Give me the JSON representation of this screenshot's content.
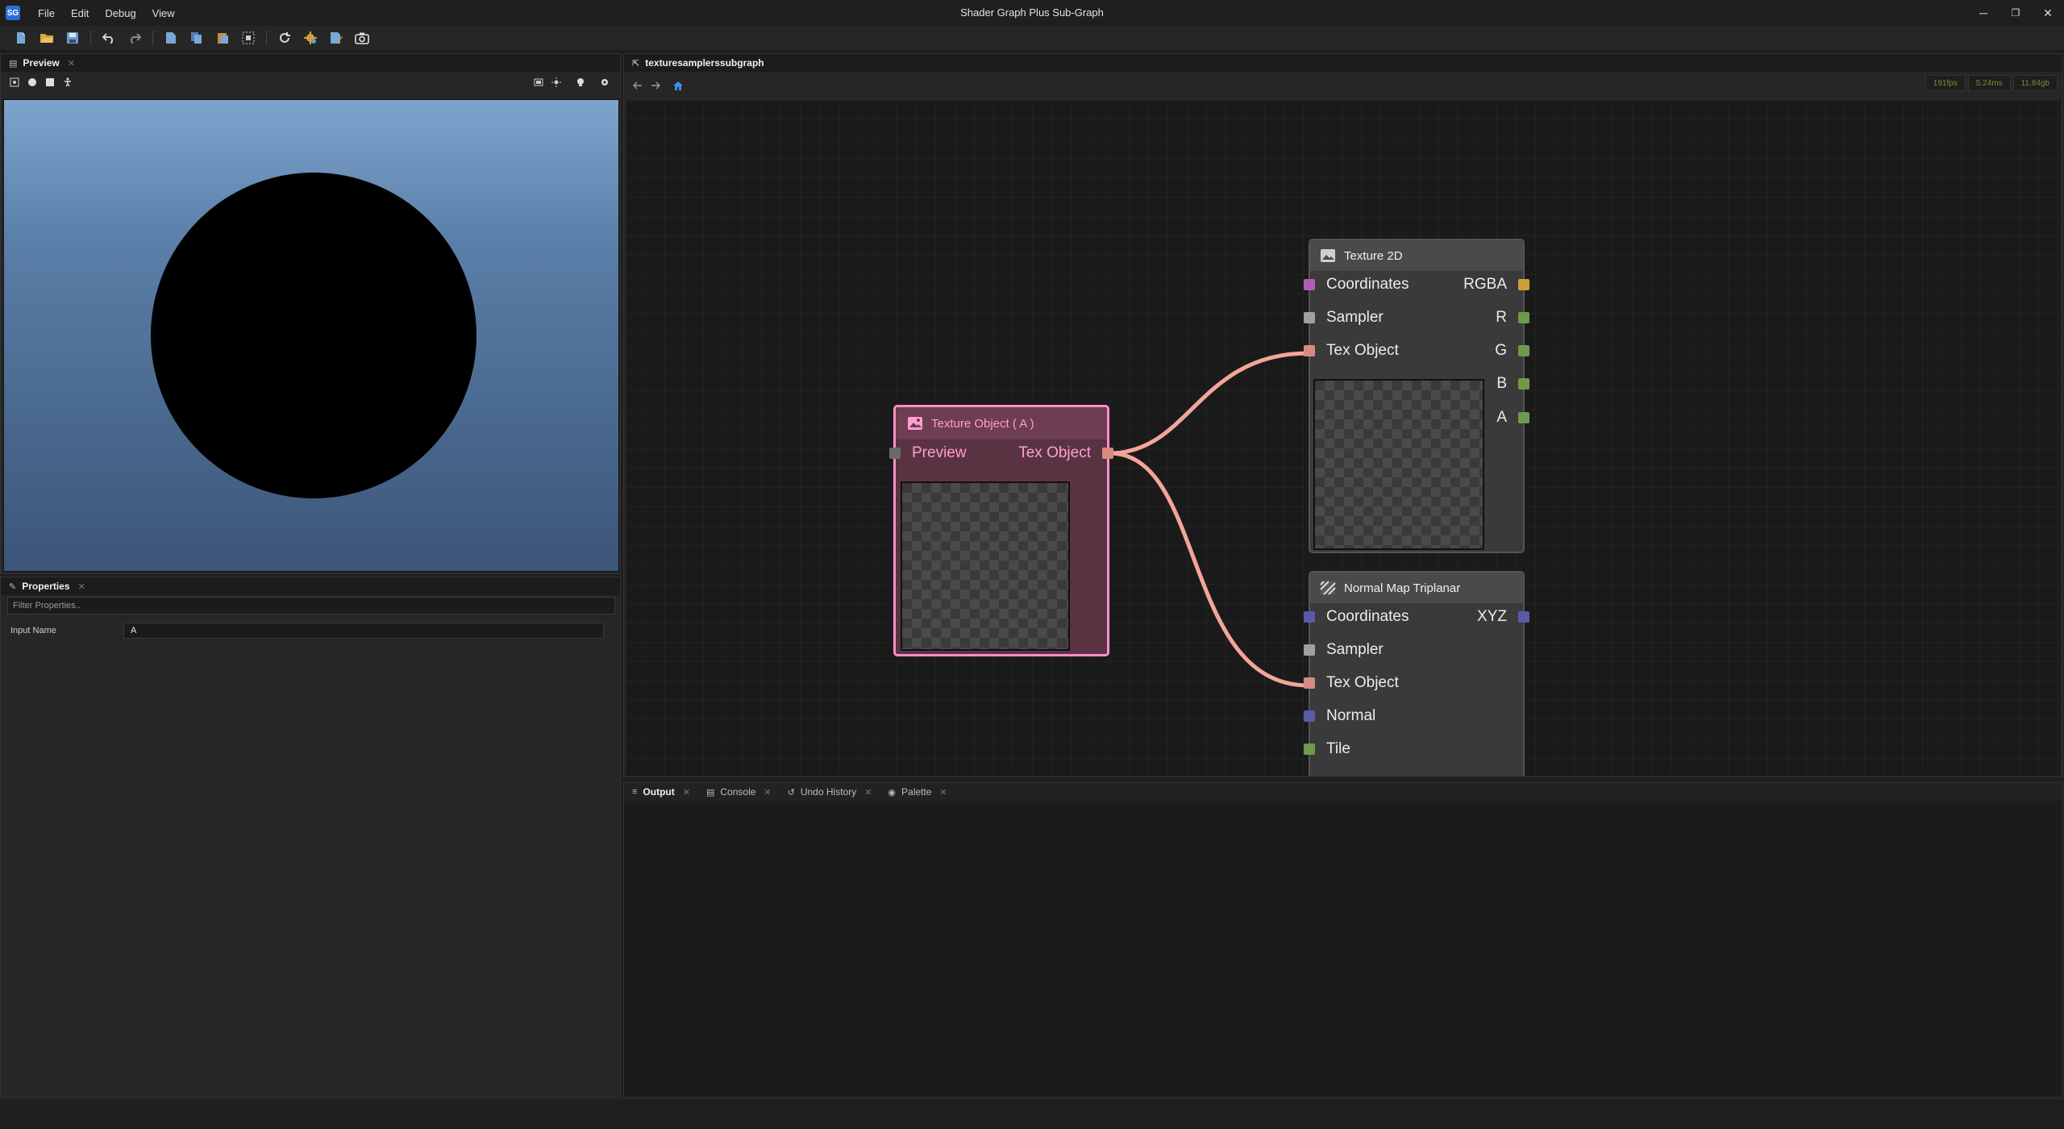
{
  "window": {
    "title": "Shader Graph Plus Sub-Graph",
    "logo_text": "SG",
    "menu": [
      "File",
      "Edit",
      "Debug",
      "View"
    ],
    "controls": {
      "minimize": "─",
      "restore": "❐",
      "close": "✕"
    }
  },
  "preview_panel": {
    "tab_label": "Preview",
    "close": "✕"
  },
  "properties_panel": {
    "tab_label": "Properties",
    "close": "✕",
    "filter_placeholder": "Filter Properties..",
    "rows": [
      {
        "label": "Input Name",
        "value": "A"
      }
    ]
  },
  "graph_panel": {
    "tab_label": "texturesamplerssubgraph",
    "stats": [
      "191fps",
      "5.24ms",
      "11.84gb"
    ]
  },
  "nodes": {
    "texture_object": {
      "title": "Texture Object ( A )",
      "inputs": [
        "Preview"
      ],
      "outputs": [
        "Tex Object"
      ]
    },
    "texture_2d": {
      "title": "Texture 2D",
      "inputs": [
        "Coordinates",
        "Sampler",
        "Tex Object"
      ],
      "outputs": [
        "RGBA",
        "R",
        "G",
        "B",
        "A"
      ]
    },
    "normal_map_triplanar": {
      "title": "Normal Map Triplanar",
      "inputs": [
        "Coordinates",
        "Sampler",
        "Tex Object",
        "Normal",
        "Tile"
      ],
      "outputs": [
        "XYZ"
      ]
    }
  },
  "output_panel": {
    "tabs": [
      {
        "label": "Output",
        "close": "✕"
      },
      {
        "label": "Console",
        "close": "✕"
      },
      {
        "label": "Undo History",
        "close": "✕"
      },
      {
        "label": "Palette",
        "close": "✕"
      }
    ]
  },
  "colors": {
    "coordinates_pin": "#b45cb4",
    "sampler_pin": "#a0a0a0",
    "texobject_pin": "#d98a80",
    "rgba_pin": "#c8a238",
    "channel_pin": "#6f9a4c",
    "vector_pin": "#5a5aa8",
    "wire": "#f4a59a",
    "selected_node_border": "#ff8fc4"
  }
}
